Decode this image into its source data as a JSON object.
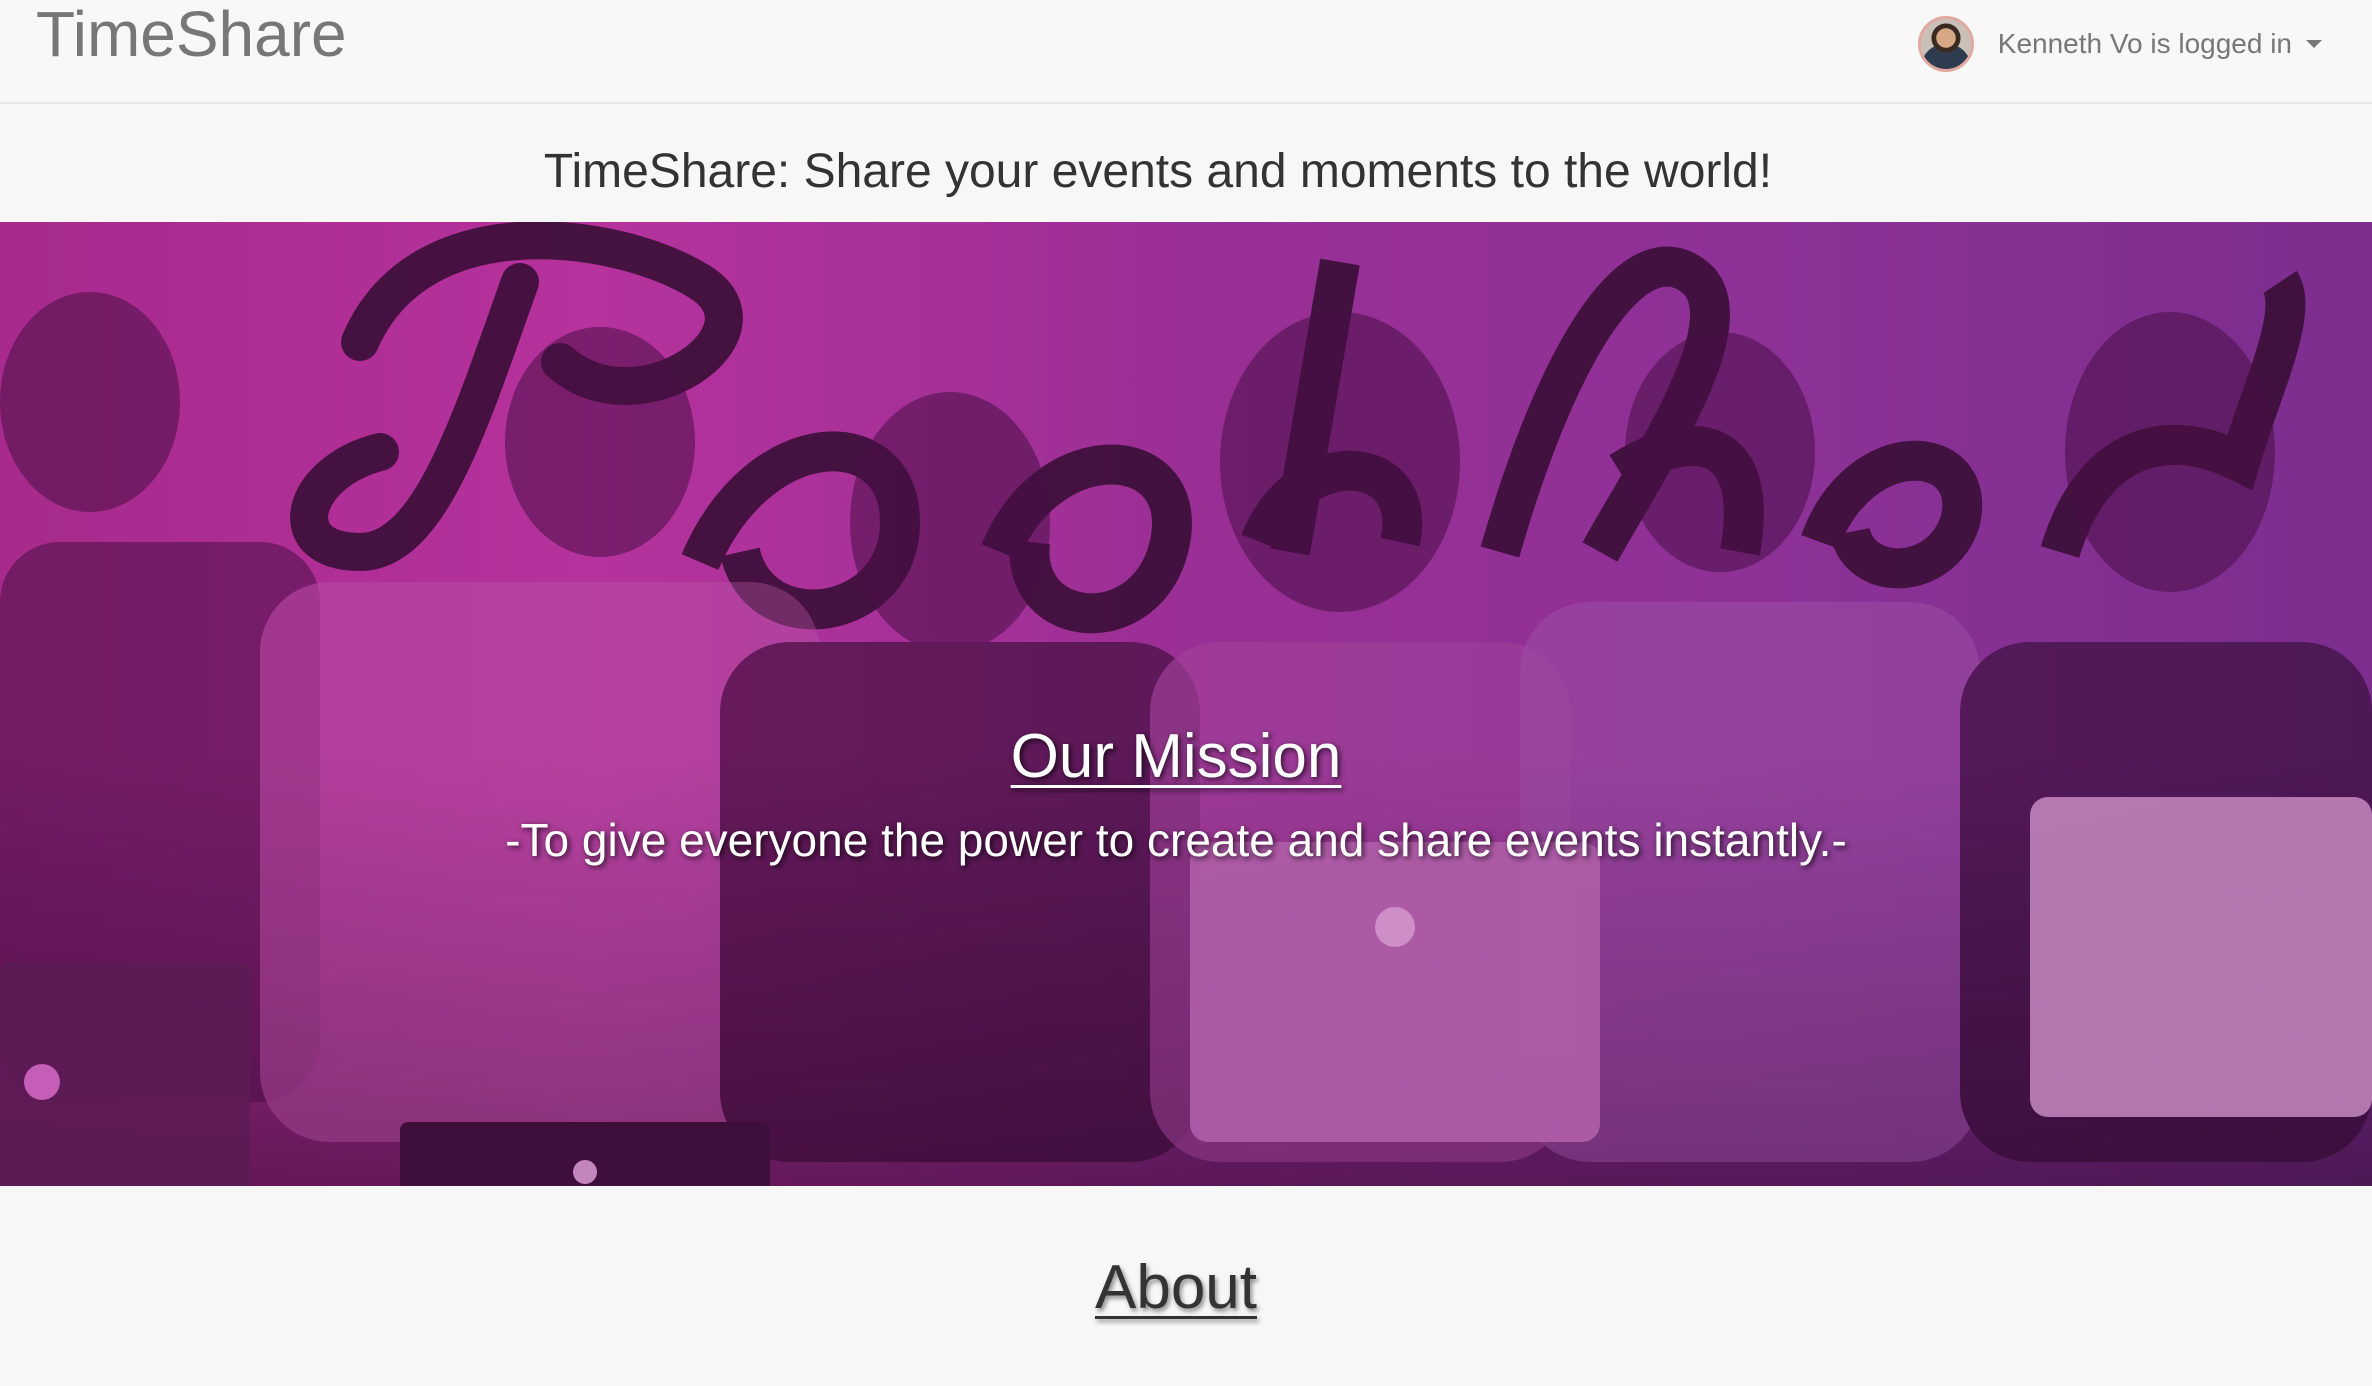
{
  "navbar": {
    "brand": "TimeShare",
    "user_label": "Kenneth Vo is logged in",
    "avatar_icon": "user-avatar-icon",
    "caret_icon": "caret-down-icon"
  },
  "tagline": "TimeShare: Share your events and moments to the world!",
  "hero": {
    "mission_title": "Our Mission",
    "mission_text": "-To give everyone the power to create and share events instantly.-",
    "overlay_color": "#a72a8c"
  },
  "about": {
    "title": "About"
  }
}
